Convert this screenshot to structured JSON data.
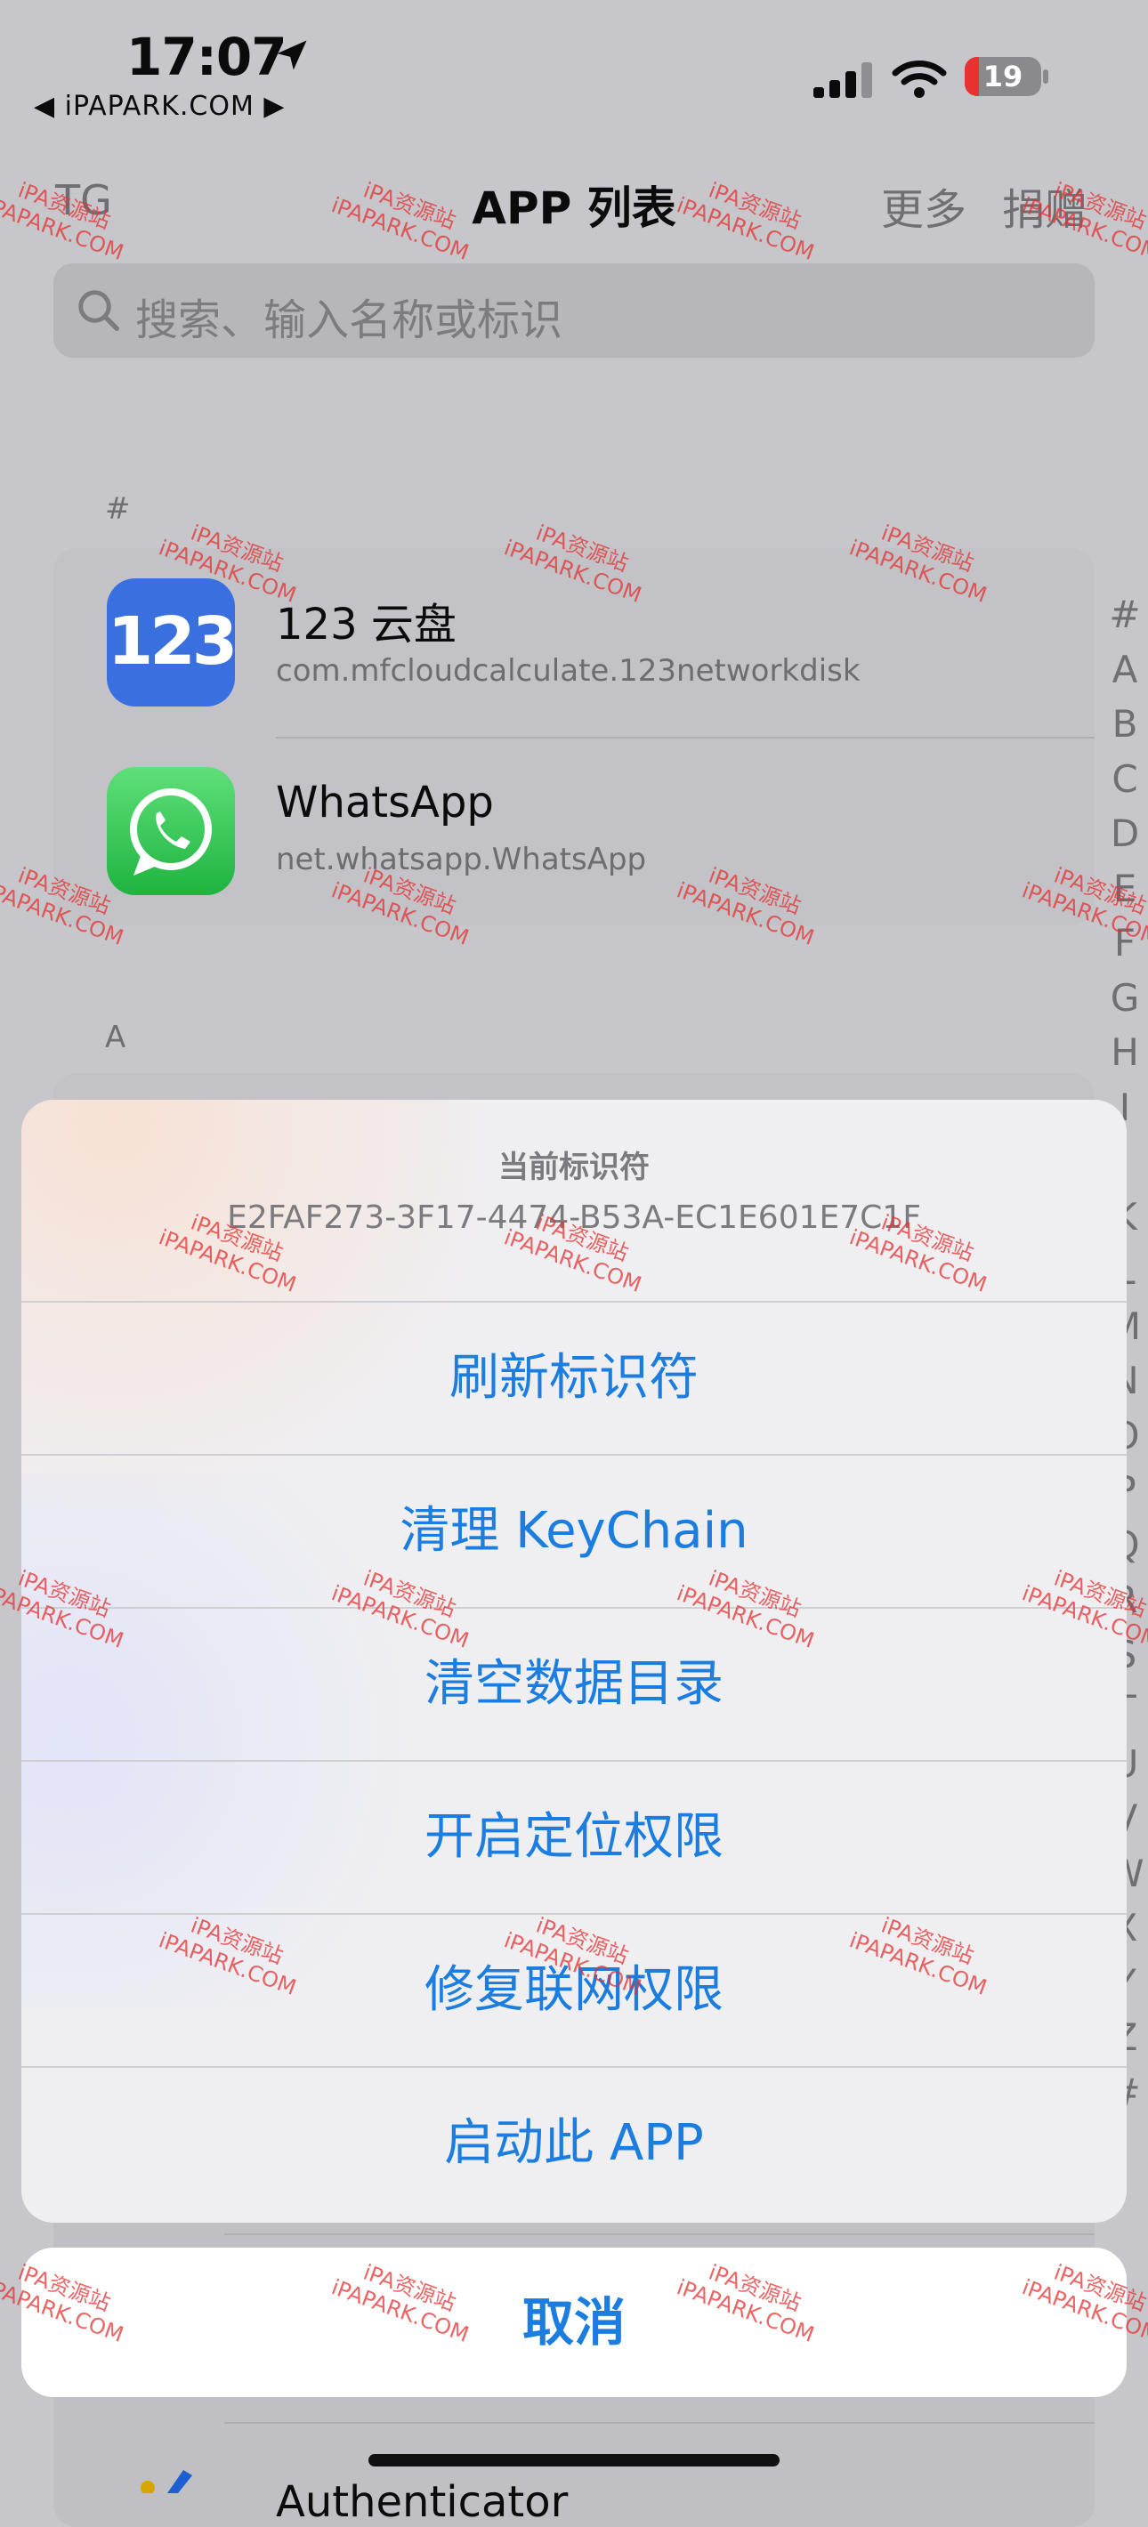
{
  "status_bar": {
    "time": "17:07",
    "back_link": "◀ iPAPARK.COM ▶",
    "battery_level": "19",
    "battery_percent": 0.19
  },
  "nav": {
    "left_label": "TG",
    "title": "APP 列表",
    "more_label": "更多",
    "donate_label": "捐赠"
  },
  "search": {
    "placeholder": "搜索、输入名称或标识"
  },
  "sections": [
    {
      "label": "#",
      "apps": [
        {
          "icon_text": "123",
          "name": "123 云盘",
          "bundle_id": "com.mfcloudcalculate.123networkdisk"
        },
        {
          "name": "WhatsApp",
          "bundle_id": "net.whatsapp.WhatsApp"
        }
      ]
    },
    {
      "label": "A"
    }
  ],
  "index_letters": [
    "#",
    "A",
    "B",
    "C",
    "D",
    "E",
    "F",
    "G",
    "H",
    "I",
    "J",
    "K",
    "L",
    "M",
    "N",
    "O",
    "P",
    "Q",
    "R",
    "S",
    "T",
    "U",
    "V",
    "W",
    "X",
    "Y",
    "Z",
    "#"
  ],
  "action_sheet": {
    "title": "当前标识符",
    "identifier": "E2FAF273-3F17-4474-B53A-EC1E601E7C1F",
    "items": [
      {
        "label": "刷新标识符"
      },
      {
        "label": "清理 KeyChain"
      },
      {
        "label": "清空数据目录"
      },
      {
        "label": "开启定位权限"
      },
      {
        "label": "修复联网权限"
      },
      {
        "label": "启动此 APP"
      }
    ],
    "cancel_label": "取消"
  },
  "peek": {
    "app_name_partial": "Authenticator"
  },
  "watermark": {
    "line1": "iPA资源站",
    "line2": "iPAPARK.COM"
  },
  "colors": {
    "accent": "#1b7de0",
    "battery_low": "#e8322f",
    "whatsapp_green": "#25d366",
    "pan123_blue": "#3a6fe0",
    "watermark": "#e43232"
  }
}
